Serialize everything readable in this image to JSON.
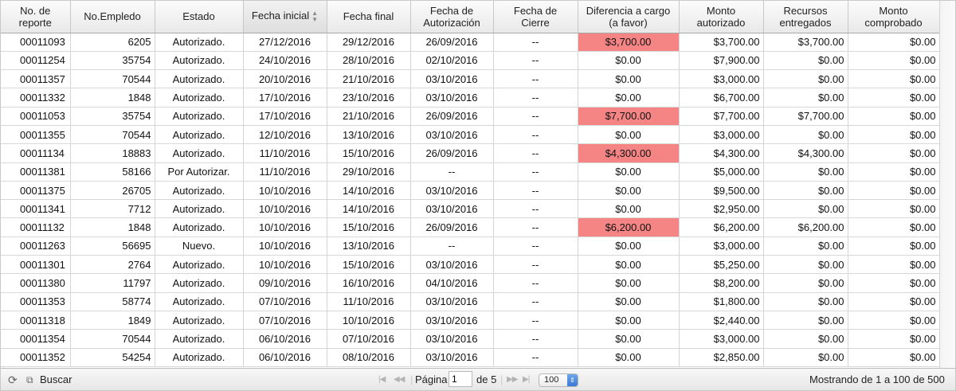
{
  "columns": [
    {
      "label": "No. de reporte"
    },
    {
      "label": "No.Empledo"
    },
    {
      "label": "Estado"
    },
    {
      "label": "Fecha inicial"
    },
    {
      "label": "Fecha final"
    },
    {
      "label": "Fecha de Autorización"
    },
    {
      "label": "Fecha de Cierre"
    },
    {
      "label": "Diferencia a cargo (a favor)"
    },
    {
      "label": "Monto autorizado"
    },
    {
      "label": "Recursos entregados"
    },
    {
      "label": "Monto comprobado"
    }
  ],
  "rows": [
    {
      "cells": [
        "00011093",
        "6205",
        "Autorizado.",
        "27/12/2016",
        "29/12/2016",
        "26/09/2016",
        "--",
        "$3,700.00",
        "$3,700.00",
        "$3,700.00",
        "$0.00"
      ],
      "highlight": true
    },
    {
      "cells": [
        "00011254",
        "35754",
        "Autorizado.",
        "24/10/2016",
        "28/10/2016",
        "02/10/2016",
        "--",
        "$0.00",
        "$7,900.00",
        "$0.00",
        "$0.00"
      ],
      "highlight": false
    },
    {
      "cells": [
        "00011357",
        "70544",
        "Autorizado.",
        "20/10/2016",
        "21/10/2016",
        "03/10/2016",
        "--",
        "$0.00",
        "$3,000.00",
        "$0.00",
        "$0.00"
      ],
      "highlight": false
    },
    {
      "cells": [
        "00011332",
        "1848",
        "Autorizado.",
        "17/10/2016",
        "23/10/2016",
        "03/10/2016",
        "--",
        "$0.00",
        "$6,700.00",
        "$0.00",
        "$0.00"
      ],
      "highlight": false
    },
    {
      "cells": [
        "00011053",
        "35754",
        "Autorizado.",
        "17/10/2016",
        "21/10/2016",
        "26/09/2016",
        "--",
        "$7,700.00",
        "$7,700.00",
        "$7,700.00",
        "$0.00"
      ],
      "highlight": true
    },
    {
      "cells": [
        "00011355",
        "70544",
        "Autorizado.",
        "12/10/2016",
        "13/10/2016",
        "03/10/2016",
        "--",
        "$0.00",
        "$3,000.00",
        "$0.00",
        "$0.00"
      ],
      "highlight": false
    },
    {
      "cells": [
        "00011134",
        "18883",
        "Autorizado.",
        "11/10/2016",
        "15/10/2016",
        "26/09/2016",
        "--",
        "$4,300.00",
        "$4,300.00",
        "$4,300.00",
        "$0.00"
      ],
      "highlight": true
    },
    {
      "cells": [
        "00011381",
        "58166",
        "Por Autorizar.",
        "11/10/2016",
        "29/10/2016",
        "--",
        "--",
        "$0.00",
        "$5,000.00",
        "$0.00",
        "$0.00"
      ],
      "highlight": false
    },
    {
      "cells": [
        "00011375",
        "26705",
        "Autorizado.",
        "10/10/2016",
        "14/10/2016",
        "03/10/2016",
        "--",
        "$0.00",
        "$9,500.00",
        "$0.00",
        "$0.00"
      ],
      "highlight": false
    },
    {
      "cells": [
        "00011341",
        "7712",
        "Autorizado.",
        "10/10/2016",
        "14/10/2016",
        "03/10/2016",
        "--",
        "$0.00",
        "$2,950.00",
        "$0.00",
        "$0.00"
      ],
      "highlight": false
    },
    {
      "cells": [
        "00011132",
        "1848",
        "Autorizado.",
        "10/10/2016",
        "15/10/2016",
        "26/09/2016",
        "--",
        "$6,200.00",
        "$6,200.00",
        "$6,200.00",
        "$0.00"
      ],
      "highlight": true
    },
    {
      "cells": [
        "00011263",
        "56695",
        "Nuevo.",
        "10/10/2016",
        "13/10/2016",
        "--",
        "--",
        "$0.00",
        "$3,000.00",
        "$0.00",
        "$0.00"
      ],
      "highlight": false
    },
    {
      "cells": [
        "00011301",
        "2764",
        "Autorizado.",
        "10/10/2016",
        "15/10/2016",
        "03/10/2016",
        "--",
        "$0.00",
        "$5,250.00",
        "$0.00",
        "$0.00"
      ],
      "highlight": false
    },
    {
      "cells": [
        "00011380",
        "11797",
        "Autorizado.",
        "09/10/2016",
        "16/10/2016",
        "04/10/2016",
        "--",
        "$0.00",
        "$8,200.00",
        "$0.00",
        "$0.00"
      ],
      "highlight": false
    },
    {
      "cells": [
        "00011353",
        "58774",
        "Autorizado.",
        "07/10/2016",
        "11/10/2016",
        "03/10/2016",
        "--",
        "$0.00",
        "$1,800.00",
        "$0.00",
        "$0.00"
      ],
      "highlight": false
    },
    {
      "cells": [
        "00011318",
        "1849",
        "Autorizado.",
        "07/10/2016",
        "10/10/2016",
        "03/10/2016",
        "--",
        "$0.00",
        "$2,440.00",
        "$0.00",
        "$0.00"
      ],
      "highlight": false
    },
    {
      "cells": [
        "00011354",
        "70544",
        "Autorizado.",
        "06/10/2016",
        "07/10/2016",
        "03/10/2016",
        "--",
        "$0.00",
        "$3,000.00",
        "$0.00",
        "$0.00"
      ],
      "highlight": false
    },
    {
      "cells": [
        "00011352",
        "54254",
        "Autorizado.",
        "06/10/2016",
        "08/10/2016",
        "03/10/2016",
        "--",
        "$0.00",
        "$2,850.00",
        "$0.00",
        "$0.00"
      ],
      "highlight": false
    }
  ],
  "highlight_color": "#f58585",
  "pager": {
    "refresh_icon": "refresh-icon",
    "search_icon": "search-icon",
    "search_label": "Buscar",
    "page_label": "Página",
    "page_value": "1",
    "of_label": "de 5",
    "rows_per_page": "100",
    "status": "Mostrando de 1 a 100 de 500"
  }
}
